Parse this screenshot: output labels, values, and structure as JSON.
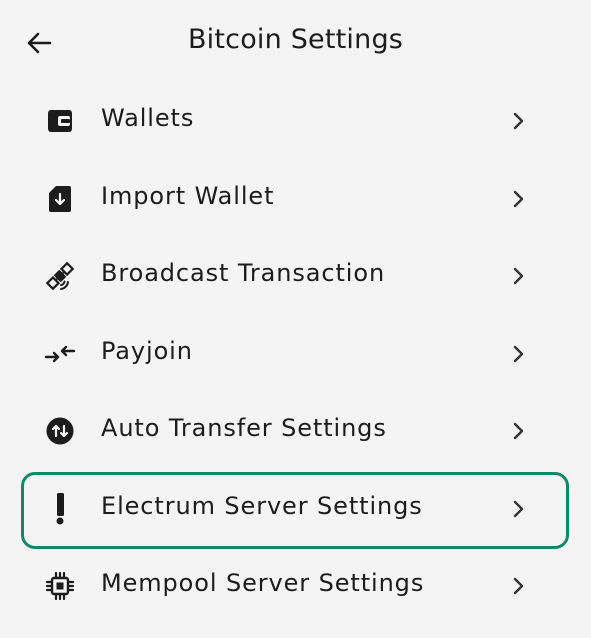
{
  "header": {
    "title": "Bitcoin Settings",
    "back_icon": "arrow-left-icon"
  },
  "menu": {
    "items": [
      {
        "label": "Wallets",
        "icon": "wallet-icon"
      },
      {
        "label": "Import Wallet",
        "icon": "import-wallet-icon"
      },
      {
        "label": "Broadcast Transaction",
        "icon": "satellite-icon"
      },
      {
        "label": "Payjoin",
        "icon": "payjoin-arrows-icon"
      },
      {
        "label": "Auto Transfer Settings",
        "icon": "auto-transfer-icon"
      },
      {
        "label": "Electrum Server Settings",
        "icon": "electrum-icon",
        "highlighted": true
      },
      {
        "label": "Mempool Server Settings",
        "icon": "chip-icon"
      }
    ],
    "chevron_icon": "chevron-right-icon"
  },
  "colors": {
    "background": "#f4f4f4",
    "text": "#1c1c1c",
    "highlight_border": "#14876a"
  }
}
